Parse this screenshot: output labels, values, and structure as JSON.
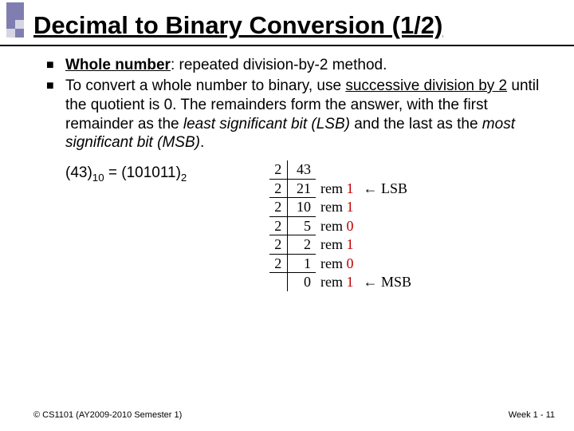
{
  "title": "Decimal to Binary Conversion (1/2)",
  "bullets": [
    {
      "lead": "Whole number",
      "rest": ": repeated division-by-2 method."
    },
    {
      "text_parts": {
        "p1": "To convert a whole number to binary, use ",
        "u1": "successive division by 2",
        "p2": " until the quotient is 0.  The remainders form the answer, with the first remainder as the ",
        "i1": "least significant bit (LSB)",
        "p3": " and the last as the ",
        "i2": "most significant bit (MSB)",
        "p4": "."
      }
    }
  ],
  "example": {
    "lhs_num": "(43)",
    "lhs_sub": "10",
    "eq": " = ",
    "rhs_num": "(101011)",
    "rhs_sub": "2"
  },
  "division": {
    "rows": [
      {
        "d": "2",
        "q": "43",
        "rem": "",
        "note": ""
      },
      {
        "d": "2",
        "q": "21",
        "rem": "1",
        "note": "LSB"
      },
      {
        "d": "2",
        "q": "10",
        "rem": "1",
        "note": ""
      },
      {
        "d": "2",
        "q": "5",
        "rem": "0",
        "note": ""
      },
      {
        "d": "2",
        "q": "2",
        "rem": "1",
        "note": ""
      },
      {
        "d": "2",
        "q": "1",
        "rem": "0",
        "note": ""
      },
      {
        "d": "",
        "q": "0",
        "rem": "1",
        "note": "MSB"
      }
    ],
    "rem_label": "rem",
    "arrow": "←"
  },
  "footer": {
    "left": "© CS1101 (AY2009-2010 Semester 1)",
    "right_prefix": "Week 1 - ",
    "right_page": "11"
  }
}
